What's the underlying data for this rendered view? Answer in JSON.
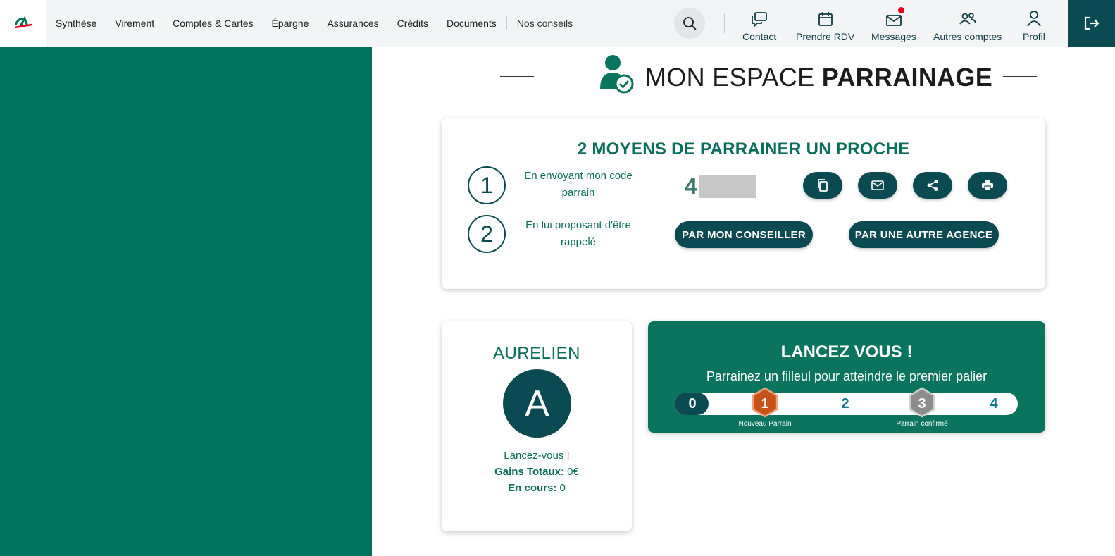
{
  "header": {
    "nav": [
      {
        "id": "synthese",
        "label": "Synthèse"
      },
      {
        "id": "virement",
        "label": "Virement"
      },
      {
        "id": "comptes",
        "label": "Comptes & Cartes"
      },
      {
        "id": "epargne",
        "label": "Épargne"
      },
      {
        "id": "assurances",
        "label": "Assurances"
      },
      {
        "id": "credits",
        "label": "Crédits"
      },
      {
        "id": "documents",
        "label": "Documents"
      }
    ],
    "nav_extra": "Nos conseils",
    "tools": [
      {
        "id": "contact",
        "label": "Contact",
        "icon": "chat-icon"
      },
      {
        "id": "rdv",
        "label": "Prendre RDV",
        "icon": "calendar-icon"
      },
      {
        "id": "messages",
        "label": "Messages",
        "icon": "mail-icon",
        "notification": true
      },
      {
        "id": "autres",
        "label": "Autres comptes",
        "icon": "users-icon"
      },
      {
        "id": "profil",
        "label": "Profil",
        "icon": "user-icon"
      }
    ],
    "colors": {
      "accent": "#00745f",
      "dark": "#0b4a52",
      "notification": "#e2001a"
    }
  },
  "title": {
    "light": "MON ESPACE ",
    "bold": "PARRAINAGE"
  },
  "ways": {
    "title": "2 MOYENS DE PARRAINER UN PROCHE",
    "step1": {
      "number": "1",
      "text": "En envoyant mon code parrain"
    },
    "step2": {
      "number": "2",
      "text": "En lui proposant d'être rappelé"
    },
    "code_visible": "4",
    "buttons": {
      "advisor": "PAR MON CONSEILLER",
      "other_branch": "PAR UNE AUTRE AGENCE"
    }
  },
  "profile": {
    "name": "AURELIEN",
    "initial": "A",
    "tagline": "Lancez-vous !",
    "gains_label": "Gains Totaux:",
    "gains_value": " 0€",
    "pending_label": "En cours:",
    "pending_value": " 0"
  },
  "progress": {
    "title": "LANCEZ VOUS !",
    "subtitle": "Parrainez un filleul pour atteindre le premier palier",
    "current": 0,
    "steps": [
      "0",
      "1",
      "2",
      "3",
      "4"
    ],
    "badge1_label": "Nouveau Parrain",
    "badge3_label": "Parrain confirmé"
  }
}
